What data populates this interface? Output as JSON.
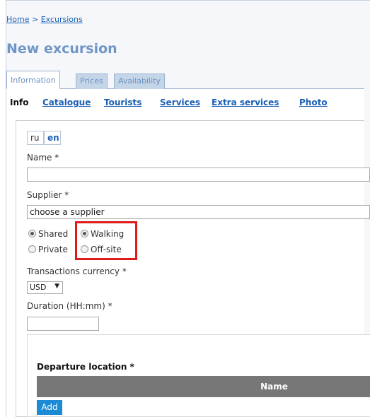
{
  "breadcrumb": {
    "home": "Home",
    "separator": ">",
    "current": "Excursions"
  },
  "page": {
    "title": "New excursion"
  },
  "tabs": [
    {
      "label": "Information",
      "active": true
    },
    {
      "label": "Prices",
      "active": false
    },
    {
      "label": "Availability",
      "active": false
    }
  ],
  "subnav": {
    "items": [
      "Info",
      "Catalogue",
      "Tourists",
      "Services",
      "Extra services",
      "Photo"
    ],
    "active": "Info"
  },
  "languages": {
    "ru": "ru",
    "en": "en",
    "selected": "en"
  },
  "form": {
    "name_label": "Name *",
    "name_value": "",
    "supplier_label": "Supplier *",
    "supplier_value": "choose a supplier",
    "options": {
      "shared": {
        "label": "Shared",
        "checked": true
      },
      "private": {
        "label": "Private",
        "checked": false
      },
      "walking": {
        "label": "Walking",
        "checked": true
      },
      "offsite": {
        "label": "Off-site",
        "checked": false
      }
    },
    "currency_label": "Transactions currency *",
    "currency_value": "USD",
    "duration_label": "Duration (HH:mm) *",
    "duration_value": ""
  },
  "departure": {
    "title": "Departure location *",
    "columns": [
      "Name"
    ],
    "add_label": "Add"
  },
  "colors": {
    "accent": "#1b8bd6",
    "highlight": "#e01919",
    "title": "#6f96c6",
    "link": "#1a5fb4"
  }
}
